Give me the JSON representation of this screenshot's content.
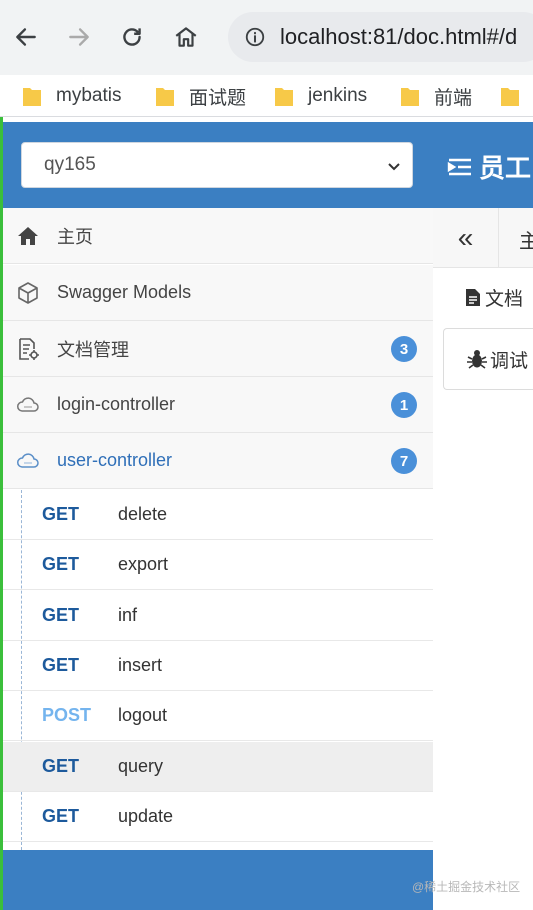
{
  "browser": {
    "url": "localhost:81/doc.html#/d"
  },
  "bookmarks": [
    {
      "label": "mybatis"
    },
    {
      "label": "面试题"
    },
    {
      "label": "jenkins"
    },
    {
      "label": "前端"
    }
  ],
  "header": {
    "group_select_value": "qy165",
    "title": "员工"
  },
  "sidebar": {
    "items": [
      {
        "label": "主页",
        "icon": "home-icon"
      },
      {
        "label": "Swagger Models",
        "icon": "cube-icon"
      },
      {
        "label": "文档管理",
        "icon": "doc-settings-icon",
        "badge": "3"
      },
      {
        "label": "login-controller",
        "icon": "cloud-icon",
        "badge": "1"
      },
      {
        "label": "user-controller",
        "icon": "cloud-icon",
        "badge": "7"
      }
    ],
    "apis": [
      {
        "method": "GET",
        "path": "delete"
      },
      {
        "method": "GET",
        "path": "export"
      },
      {
        "method": "GET",
        "path": "inf"
      },
      {
        "method": "GET",
        "path": "insert"
      },
      {
        "method": "POST",
        "path": "logout"
      },
      {
        "method": "GET",
        "path": "query",
        "selected": true
      },
      {
        "method": "GET",
        "path": "update"
      }
    ]
  },
  "content": {
    "prev_tab_glyph": "«",
    "home_tab_label": "主",
    "doc_tab_label": "文档",
    "debug_tab_label": "调试"
  },
  "watermark": "@稀土掘金技术社区",
  "colors": {
    "primary": "#3b7fc2",
    "get": "#1d5a9c",
    "post": "#74b4ee",
    "badge": "#4a90d9"
  }
}
